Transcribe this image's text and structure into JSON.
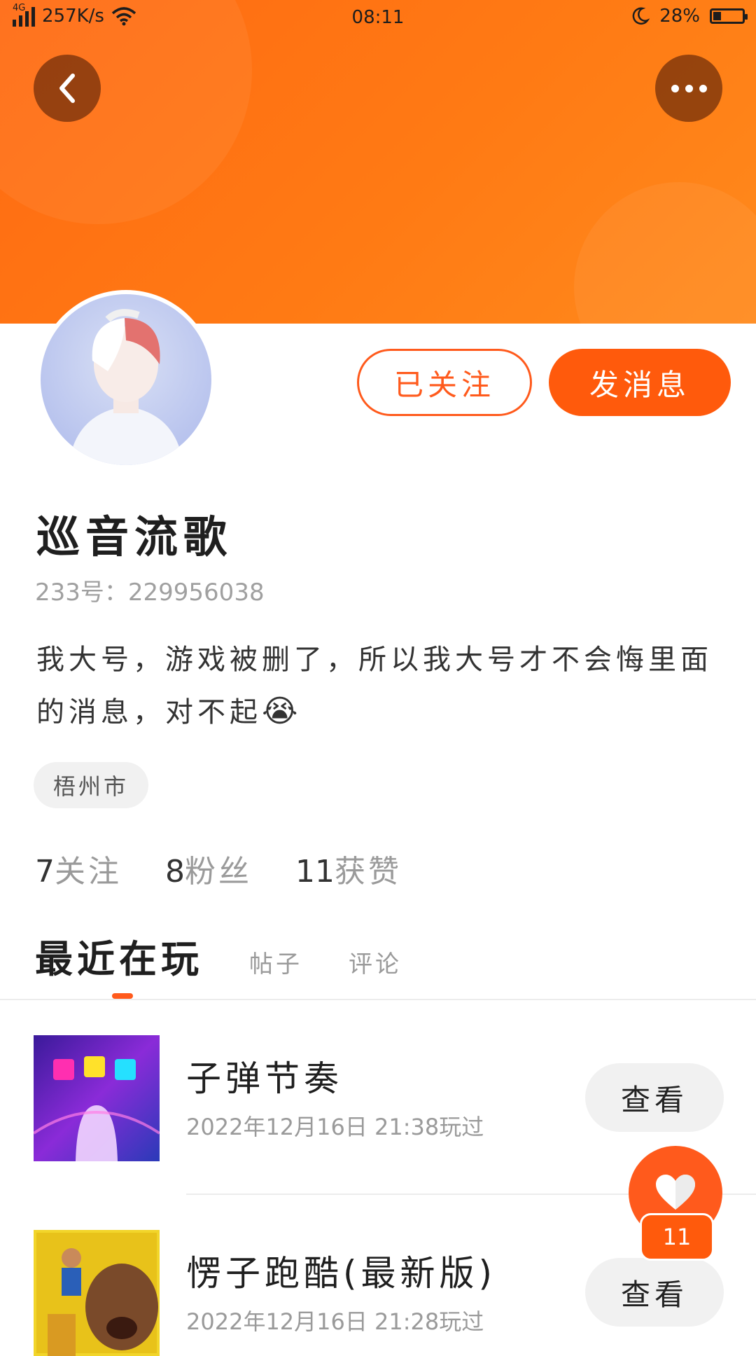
{
  "status_bar": {
    "network_type": "4G",
    "speed": "257K/s",
    "time": "08:11",
    "battery": "28%",
    "battery_level": 0.28
  },
  "header": {
    "back_icon": "chevron-left-icon",
    "more_icon": "more-horizontal-icon"
  },
  "profile": {
    "follow_button": "已关注",
    "message_button": "发消息",
    "nickname": "巡音流歌",
    "id_text": "233号：229956038",
    "bio_text": "我大号，游戏被删了，所以我大号才不会悔里面的消息，对不起",
    "bio_emoji": "😭",
    "location": "梧州市",
    "following_count": "7",
    "following_label": "关注",
    "fans_count": "8",
    "fans_label": "粉丝",
    "likes_count": "11",
    "likes_label": "获赞"
  },
  "tabs": [
    {
      "label": "最近在玩",
      "active": true
    },
    {
      "label": "帖子",
      "active": false
    },
    {
      "label": "评论",
      "active": false
    }
  ],
  "games": [
    {
      "title": "子弹节奏",
      "played": "2022年12月16日 21:38玩过",
      "button": "查看"
    },
    {
      "title": "愣子跑酷(最新版)",
      "played": "2022年12月16日 21:28玩过",
      "button": "查看"
    }
  ],
  "like_fab": {
    "icon": "heart-icon",
    "count": "11"
  },
  "colors": {
    "accent": "#ff5a1c",
    "header_orange": "#ff7a14"
  }
}
